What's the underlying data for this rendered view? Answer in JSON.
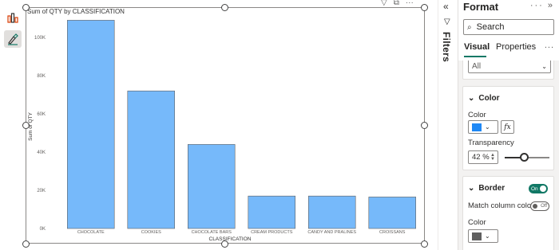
{
  "visual": {
    "title": "Sum of QTY by CLASSIFICATION",
    "toolbar_icons": [
      "filter-icon",
      "focus-mode-icon",
      "more-options-icon"
    ]
  },
  "chart_data": {
    "type": "bar",
    "title": "Sum of QTY by CLASSIFICATION",
    "xlabel": "CLASSIFICATION",
    "ylabel": "Sum of QTY",
    "categories": [
      "CHOCOLATE",
      "COOKIES",
      "CHOCOLATE BARS",
      "CREAM PRODUCTS",
      "CANDY AND PRALINES",
      "CROISSANS"
    ],
    "values": [
      109000,
      72000,
      44000,
      17000,
      17000,
      16500
    ],
    "ylim": [
      0,
      100000
    ],
    "yticks": [
      0,
      20000,
      40000,
      60000,
      80000,
      100000
    ],
    "ytick_labels": [
      "0K",
      "20K",
      "40K",
      "60K",
      "80K",
      "100K"
    ],
    "bar_color": "#76b9fa",
    "bar_border_color": "#5f5f5f",
    "grid": false
  },
  "filters_pane": {
    "label": "Filters",
    "collapse_icon": "double-chevron-left-icon"
  },
  "format_pane": {
    "title": "Format",
    "header_icons": [
      "more-options-icon",
      "double-chevron-right-icon"
    ],
    "search_placeholder": "Search",
    "tabs": [
      {
        "label": "Visual",
        "active": true
      },
      {
        "label": "Properties",
        "active": false
      }
    ],
    "tabs_more": "...",
    "apply_to_value": "All",
    "color_section": {
      "title": "Color",
      "color_label": "Color",
      "color_value": "#1e88f5",
      "fx_label": "fx",
      "transparency_label": "Transparency",
      "transparency_value": "42 %",
      "transparency_level": 0.42
    },
    "border_section": {
      "title": "Border",
      "toggle_label": "On",
      "toggle_state": true,
      "match_column_color_label": "Match column color",
      "match_toggle_label": "Off",
      "match_toggle_state": false,
      "color_label": "Color",
      "color_value": "#5f5f5f"
    }
  },
  "colors": {
    "accent": "#117865",
    "pane_bg": "#f3f2f1"
  }
}
